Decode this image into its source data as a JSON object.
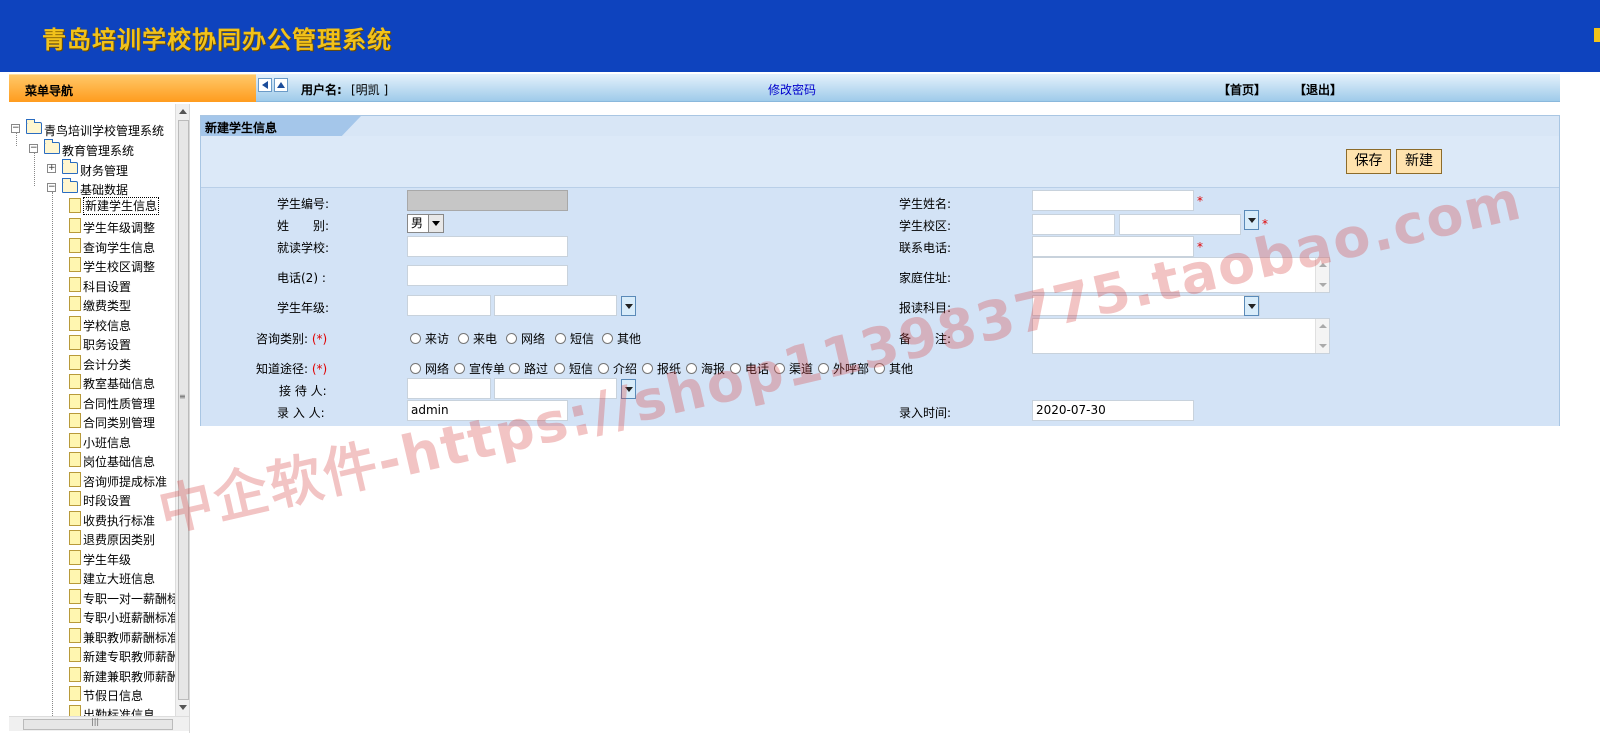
{
  "header": {
    "title": "青岛培训学校协同办公管理系统"
  },
  "menu": {
    "title": "菜单导航"
  },
  "topbar": {
    "user_label": "用户名:",
    "user_name": "[明凯 ]",
    "change_password": "修改密码",
    "home": "【首页】",
    "logout": "【退出】"
  },
  "tree": {
    "root": "青鸟培训学校管理系统",
    "edu": "教育管理系统",
    "finance": "财务管理",
    "basic": "基础数据",
    "items": [
      "新建学生信息",
      "学生年级调整",
      "查询学生信息",
      "学生校区调整",
      "科目设置",
      "缴费类型",
      "学校信息",
      "职务设置",
      "会计分类",
      "教室基础信息",
      "合同性质管理",
      "合同类别管理",
      "小班信息",
      "岗位基础信息",
      "咨询师提成标准",
      "时段设置",
      "收费执行标准",
      "退费原因类别",
      "学生年级",
      "建立大班信息",
      "专职一对一薪酬标",
      "专职小班薪酬标准",
      "兼职教师薪酬标准",
      "新建专职教师薪酬",
      "新建兼职教师薪酬",
      "节假日信息",
      "出勤标准信息"
    ]
  },
  "panel": {
    "title": "新建学生信息",
    "save": "保存",
    "new": "新建"
  },
  "form": {
    "student_no": "学生编号:",
    "gender": "姓　　别:",
    "gender_value": "男",
    "school": "就读学校:",
    "phone2": "电话(2) :",
    "grade": "学生年级:",
    "inquiry_type": "咨询类别:",
    "inquiry_options": [
      "来访",
      "来电",
      "网络",
      "短信",
      "其他"
    ],
    "channel": "知道途径:",
    "channel_options": [
      "网络",
      "宣传单",
      "路过",
      "短信",
      "介绍",
      "报纸",
      "海报",
      "电话",
      "渠道",
      "外呼部",
      "其他"
    ],
    "receptionist": "接 待 人:",
    "entered_by": "录 入 人:",
    "entered_by_value": "admin",
    "student_name": "学生姓名:",
    "campus": "学生校区:",
    "contact_phone": "联系电话:",
    "address": "家庭住址:",
    "subject": "报读科目:",
    "remark": "备　　注:",
    "entry_time": "录入时间:",
    "entry_time_value": "2020-07-30",
    "required_mark": "(*)",
    "star": "*"
  },
  "watermark": "中企软件-https://shop113983775.taobao.com",
  "colors": {
    "banner": "#0e43be",
    "title": "#f2c21a",
    "menu_head": "#ff9c1e",
    "panel": "#d3e3f6"
  }
}
